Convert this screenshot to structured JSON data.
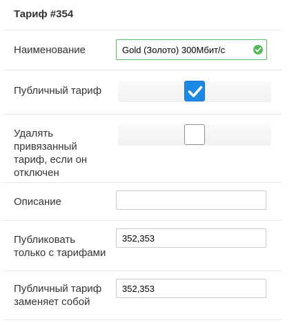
{
  "title": "Тариф #354",
  "fields": {
    "name": {
      "label": "Наименование",
      "value": "Gold (Золото) 300Мбит/с"
    },
    "public": {
      "label": "Публичный тариф",
      "checked": true
    },
    "delete_linked": {
      "label_lines": [
        "Удалять",
        "привязанный",
        "тариф, если он",
        "отключен"
      ],
      "checked": false
    },
    "description": {
      "label": "Описание",
      "value": ""
    },
    "publish_with": {
      "label_lines": [
        "Публиковать",
        "только с тарифами"
      ],
      "value": "352,353"
    },
    "replaces": {
      "label_lines": [
        "Публичный тариф",
        "заменяет собой"
      ],
      "value": "352,353"
    }
  },
  "colors": {
    "valid_border": "#5cb85c",
    "checkbox_on": "#1e88e5"
  }
}
